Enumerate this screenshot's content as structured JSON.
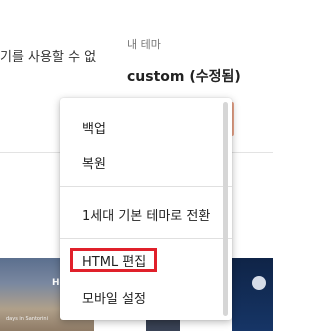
{
  "left_text": "기를 사용할 수 없",
  "my_theme": {
    "label": "내 테마",
    "name": "custom (수정됨)"
  },
  "thumbnails": {
    "left_title": "Here an",
    "left_caption": "days in Santorini"
  },
  "menu": {
    "items": [
      {
        "label": "백업"
      },
      {
        "label": "복원"
      },
      {
        "label": "1세대 기본 테마로 전환"
      },
      {
        "label": "HTML 편집"
      },
      {
        "label": "모바일 설정"
      }
    ]
  },
  "colors": {
    "highlight": "#e0202a",
    "accent": "#e8a48a"
  }
}
